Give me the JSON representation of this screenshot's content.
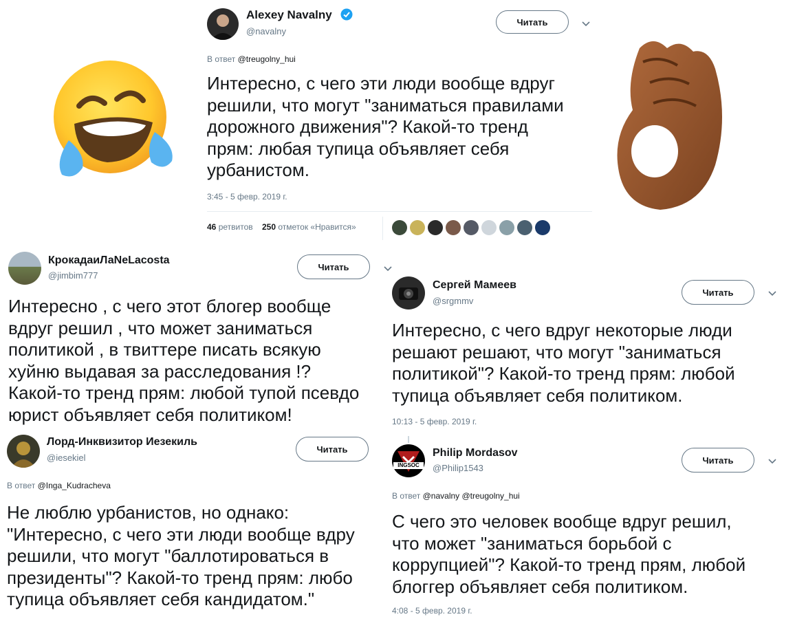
{
  "colors": {
    "text": "#14171a",
    "muted": "#657786",
    "verified": "#1da1f2",
    "border": "#e6ecf0"
  },
  "tweets": [
    {
      "author": "Alexey Navalny",
      "handle": "@navalny",
      "verified": true,
      "follow_label": "Читать",
      "reply_prefix": "В ответ",
      "reply_to": "@treugolny_hui",
      "text": "Интересно, с чего эти люди вообще вдруг\nрешили, что могут \"заниматься правилами\nдорожного движения\"? Какой-то тренд\nпрям: любая тупица объявляет себя\nурбанистом.",
      "timestamp": "3:45 - 5 февр. 2019 г.",
      "retweets_count": "46",
      "retweets_label": "ретвитов",
      "likes_count": "250",
      "likes_label": "отметок «Нравится»"
    },
    {
      "author": "КрокадаиЛаNeLacosta",
      "handle": "@jimbim777",
      "follow_label": "Читать",
      "text": "Интересно , с чего этот блогер вообще\nвдруг решил , что может заниматься\nполитикой , в твиттере писать всякую\nхуйню выдавая за расследования !?\nКакой-то тренд прям: любой тупой псевдо\nюрист  объявляет себя политиком!"
    },
    {
      "author": "Сергей Мамеев",
      "handle": "@srgmmv",
      "follow_label": "Читать",
      "text": "Интересно, с чего вдруг некоторые люди\nрешают решают, что могут \"заниматься\nполитикой\"? Какой-то тренд прям: любой\nтупица объявляет себя политиком.",
      "timestamp": "10:13 - 5 февр. 2019 г."
    },
    {
      "author": "Лорд-Инквизитор Иезекиль",
      "handle": "@iesekiel",
      "follow_label": "Читать",
      "reply_prefix": "В ответ",
      "reply_to": "@Inga_Kudracheva",
      "text": "Не люблю урбанистов, но однако:\n\"Интересно, с чего эти люди вообще вдру\nрешили, что могут \"баллотироваться в\nпрезиденты\"? Какой-то тренд прям: любо\nтупица объявляет себя кандидатом.\""
    },
    {
      "author": "Philip Mordasov",
      "handle": "@Philip1543",
      "avatar_text": "INGSOC",
      "follow_label": "Читать",
      "reply_prefix": "В ответ",
      "reply_to": "@navalny @treugolny_hui",
      "text": "С чего это человек вообще вдруг решил,\nчто может \"заниматься борьбой с\nкоррупцией\"? Какой-то тренд прям, любой\nблоггер объявляет себя политиком.",
      "timestamp": "4:08 - 5 февр. 2019 г."
    }
  ]
}
